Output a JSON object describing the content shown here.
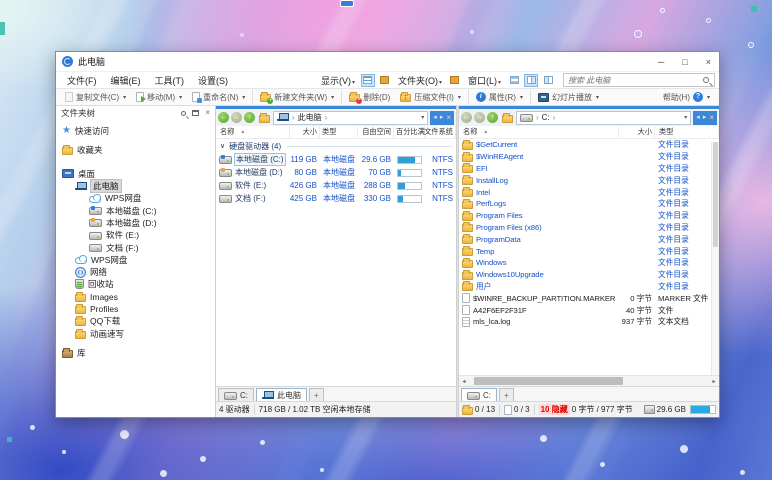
{
  "window": {
    "title": "此电脑"
  },
  "menubar": {
    "menus": [
      "文件(F)",
      "编辑(E)",
      "工具(T)",
      "设置(S)"
    ],
    "view_menu": "显示(V)",
    "folders_menu": "文件夹(O)",
    "window_menu": "窗口(L)",
    "search_placeholder": "搜索 此电脑"
  },
  "toolbar": {
    "copy": "复制文件(C)",
    "move": "移动(M)",
    "rename": "重命名(N)",
    "new_folder": "新建文件夹(W)",
    "delete": "删除(D)",
    "compress": "压缩文件(I)",
    "properties": "属性(R)",
    "slideshow": "幻灯片播放",
    "help": "帮助(H)"
  },
  "tree": {
    "header": "文件夹树",
    "items": [
      {
        "label": "快速访问"
      },
      {
        "label": "收藏夹"
      },
      {
        "label": "桌面"
      },
      {
        "label": "此电脑"
      },
      {
        "label": "WPS网盘"
      },
      {
        "label": "本地磁盘 (C:)"
      },
      {
        "label": "本地磁盘 (D:)"
      },
      {
        "label": "软件 (E:)"
      },
      {
        "label": "文档 (F:)"
      },
      {
        "label": "WPS网盘"
      },
      {
        "label": "网络"
      },
      {
        "label": "回收站"
      },
      {
        "label": "Images"
      },
      {
        "label": "Profiles"
      },
      {
        "label": "QQ下载"
      },
      {
        "label": "动画速写"
      },
      {
        "label": "库"
      }
    ]
  },
  "mid": {
    "path": "此电脑",
    "columns": [
      "名称",
      "大小",
      "类型",
      "自由空间",
      "百分比满",
      "文件系统"
    ],
    "group": "硬盘驱动器 (4)",
    "rows": [
      {
        "name": "本地磁盘 (C:)",
        "size": "119 GB",
        "type": "本地磁盘",
        "free": "29.6 GB",
        "pct": 75,
        "fs": "NTFS"
      },
      {
        "name": "本地磁盘 (D:)",
        "size": "80 GB",
        "type": "本地磁盘",
        "free": "70 GB",
        "pct": 12,
        "fs": "NTFS"
      },
      {
        "name": "软件 (E:)",
        "size": "426 GB",
        "type": "本地磁盘",
        "free": "288 GB",
        "pct": 32,
        "fs": "NTFS"
      },
      {
        "name": "文档 (F:)",
        "size": "425 GB",
        "type": "本地磁盘",
        "free": "330 GB",
        "pct": 22,
        "fs": "NTFS"
      }
    ],
    "tabs": [
      "C:",
      "此电脑"
    ],
    "status": {
      "drives": "4 驱动器",
      "space": "718 GB / 1.02 TB 空闲本地存储"
    }
  },
  "rgt": {
    "path": "C:",
    "columns": [
      "名称",
      "大小",
      "类型"
    ],
    "rows": [
      {
        "name": "$GetCurrent",
        "size": "",
        "type": "文件目录"
      },
      {
        "name": "$WinREAgent",
        "size": "",
        "type": "文件目录"
      },
      {
        "name": "EFI",
        "size": "",
        "type": "文件目录"
      },
      {
        "name": "InstallLog",
        "size": "",
        "type": "文件目录"
      },
      {
        "name": "Intel",
        "size": "",
        "type": "文件目录"
      },
      {
        "name": "PerfLogs",
        "size": "",
        "type": "文件目录"
      },
      {
        "name": "Program Files",
        "size": "",
        "type": "文件目录"
      },
      {
        "name": "Program Files (x86)",
        "size": "",
        "type": "文件目录"
      },
      {
        "name": "ProgramData",
        "size": "",
        "type": "文件目录"
      },
      {
        "name": "Temp",
        "size": "",
        "type": "文件目录"
      },
      {
        "name": "Windows",
        "size": "",
        "type": "文件目录"
      },
      {
        "name": "Windows10Upgrade",
        "size": "",
        "type": "文件目录"
      },
      {
        "name": "用户",
        "size": "",
        "type": "文件目录"
      },
      {
        "name": "$WINRE_BACKUP_PARTITION.MARKER",
        "size": "0 字节",
        "type": "MARKER 文件"
      },
      {
        "name": "A42F6EF2F31F",
        "size": "40 字节",
        "type": "文件"
      },
      {
        "name": "mls_lca.log",
        "size": "937 字节",
        "type": "文本文档"
      }
    ],
    "tabs": [
      "C:"
    ],
    "status": {
      "folders": "0 / 13",
      "files": "0 / 3",
      "hidden": "10 隐藏",
      "bytes": "0 字节 / 977 字节",
      "disk": "29.6 GB",
      "disk_pct": 78
    }
  }
}
